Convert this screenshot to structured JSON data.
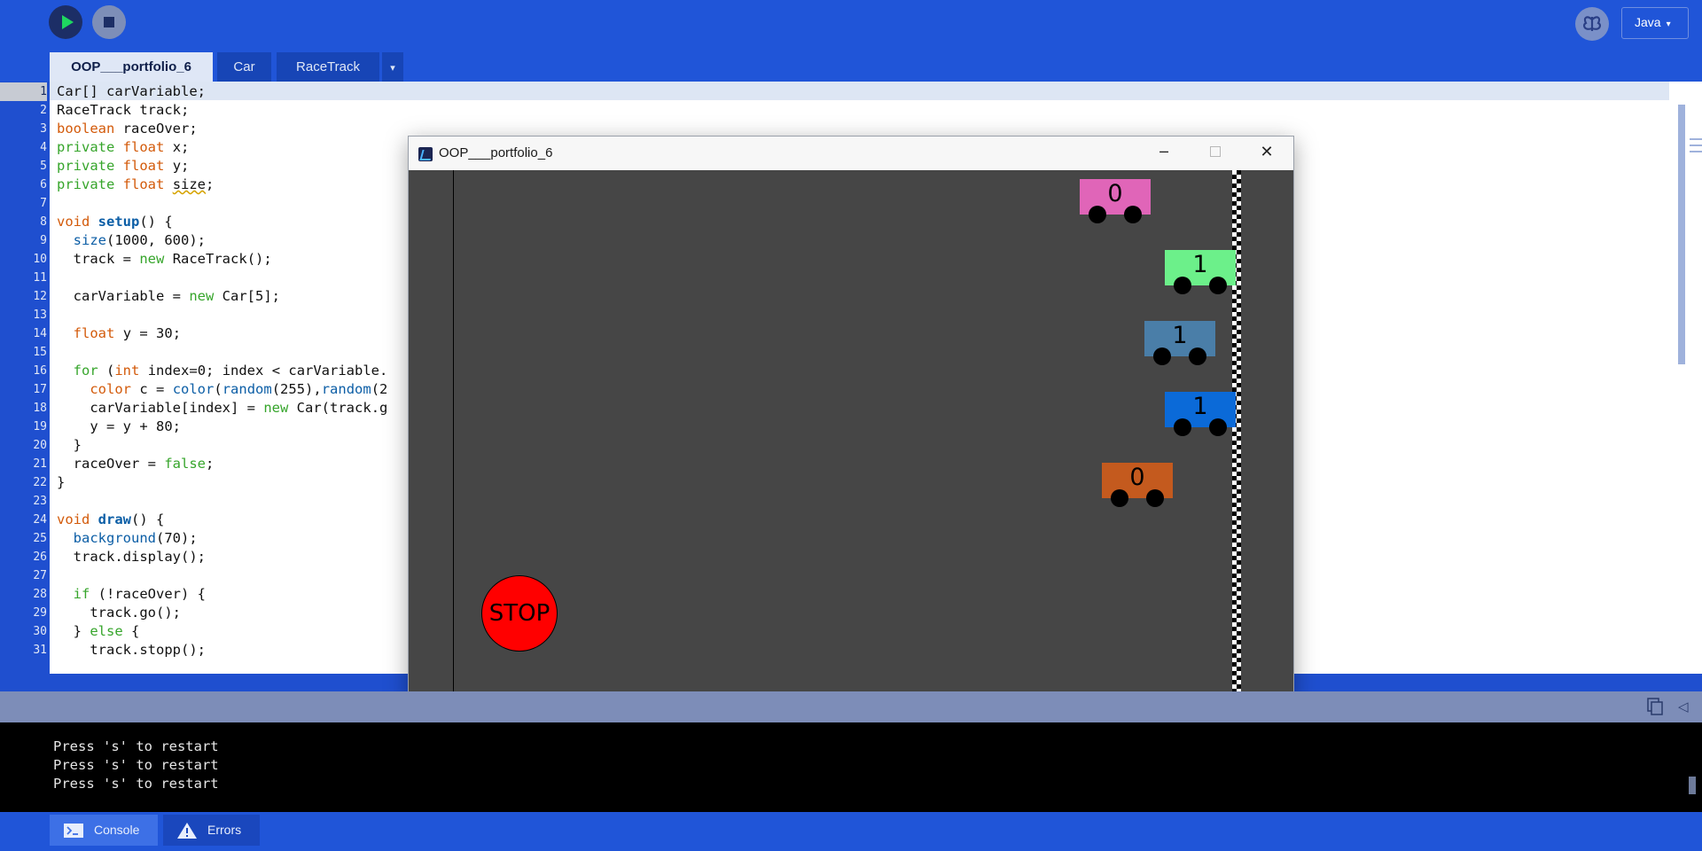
{
  "toolbar": {
    "run_icon": "play-icon",
    "stop_icon": "stop-icon",
    "mode_icon": "butterfly-icon",
    "language": "Java",
    "language_caret": "▾"
  },
  "tabs": [
    {
      "label": "OOP___portfolio_6",
      "active": true
    },
    {
      "label": "Car",
      "active": false
    },
    {
      "label": "RaceTrack",
      "active": false
    }
  ],
  "tabs_more": "▾",
  "editor": {
    "current_line": 1,
    "line_numbers": [
      "1",
      "2",
      "3",
      "4",
      "5",
      "6",
      "7",
      "8",
      "9",
      "10",
      "11",
      "12",
      "13",
      "14",
      "15",
      "16",
      "17",
      "18",
      "19",
      "20",
      "21",
      "22",
      "23",
      "24",
      "25",
      "26",
      "27",
      "28",
      "29",
      "30",
      "31"
    ],
    "lines": [
      "Car[] carVariable;",
      "RaceTrack track;",
      "boolean raceOver;",
      "private float x;",
      "private float y;",
      "private float size;",
      "",
      "void setup() {",
      "  size(1000, 600);",
      "  track = new RaceTrack();",
      "",
      "  carVariable = new Car[5];",
      "",
      "  float y = 30;",
      "",
      "  for (int index=0; index < carVariable.",
      "    color c = color(random(255),random(2",
      "    carVariable[index] = new Car(track.g",
      "    y = y + 80;",
      "  }",
      "  raceOver = false;",
      "}",
      "",
      "void draw() {",
      "  background(70);",
      "  track.display();",
      "",
      "  if (!raceOver) {",
      "    track.go();",
      "  } else {",
      "    track.stopp();"
    ]
  },
  "sketch": {
    "title": "OOP___portfolio_6",
    "window_buttons": {
      "minimize": "─",
      "close": "✕"
    },
    "background": "#464646",
    "cars": [
      {
        "label": "0",
        "color": "#e065b8"
      },
      {
        "label": "1",
        "color": "#6cf08a"
      },
      {
        "label": "1",
        "color": "#4a7ea8"
      },
      {
        "label": "1",
        "color": "#0b6ad8"
      },
      {
        "label": "0",
        "color": "#c45a1e"
      }
    ],
    "stop_button": "STOP",
    "stop_color": "#ff0000"
  },
  "console": {
    "lines": [
      "Press 's' to restart",
      "Press 's' to restart",
      "Press 's' to restart"
    ],
    "toggle_icon": "◁"
  },
  "bottom_tabs": [
    {
      "label": "Console",
      "icon": "terminal-icon",
      "active": true
    },
    {
      "label": "Errors",
      "icon": "warning-icon",
      "active": false
    }
  ]
}
